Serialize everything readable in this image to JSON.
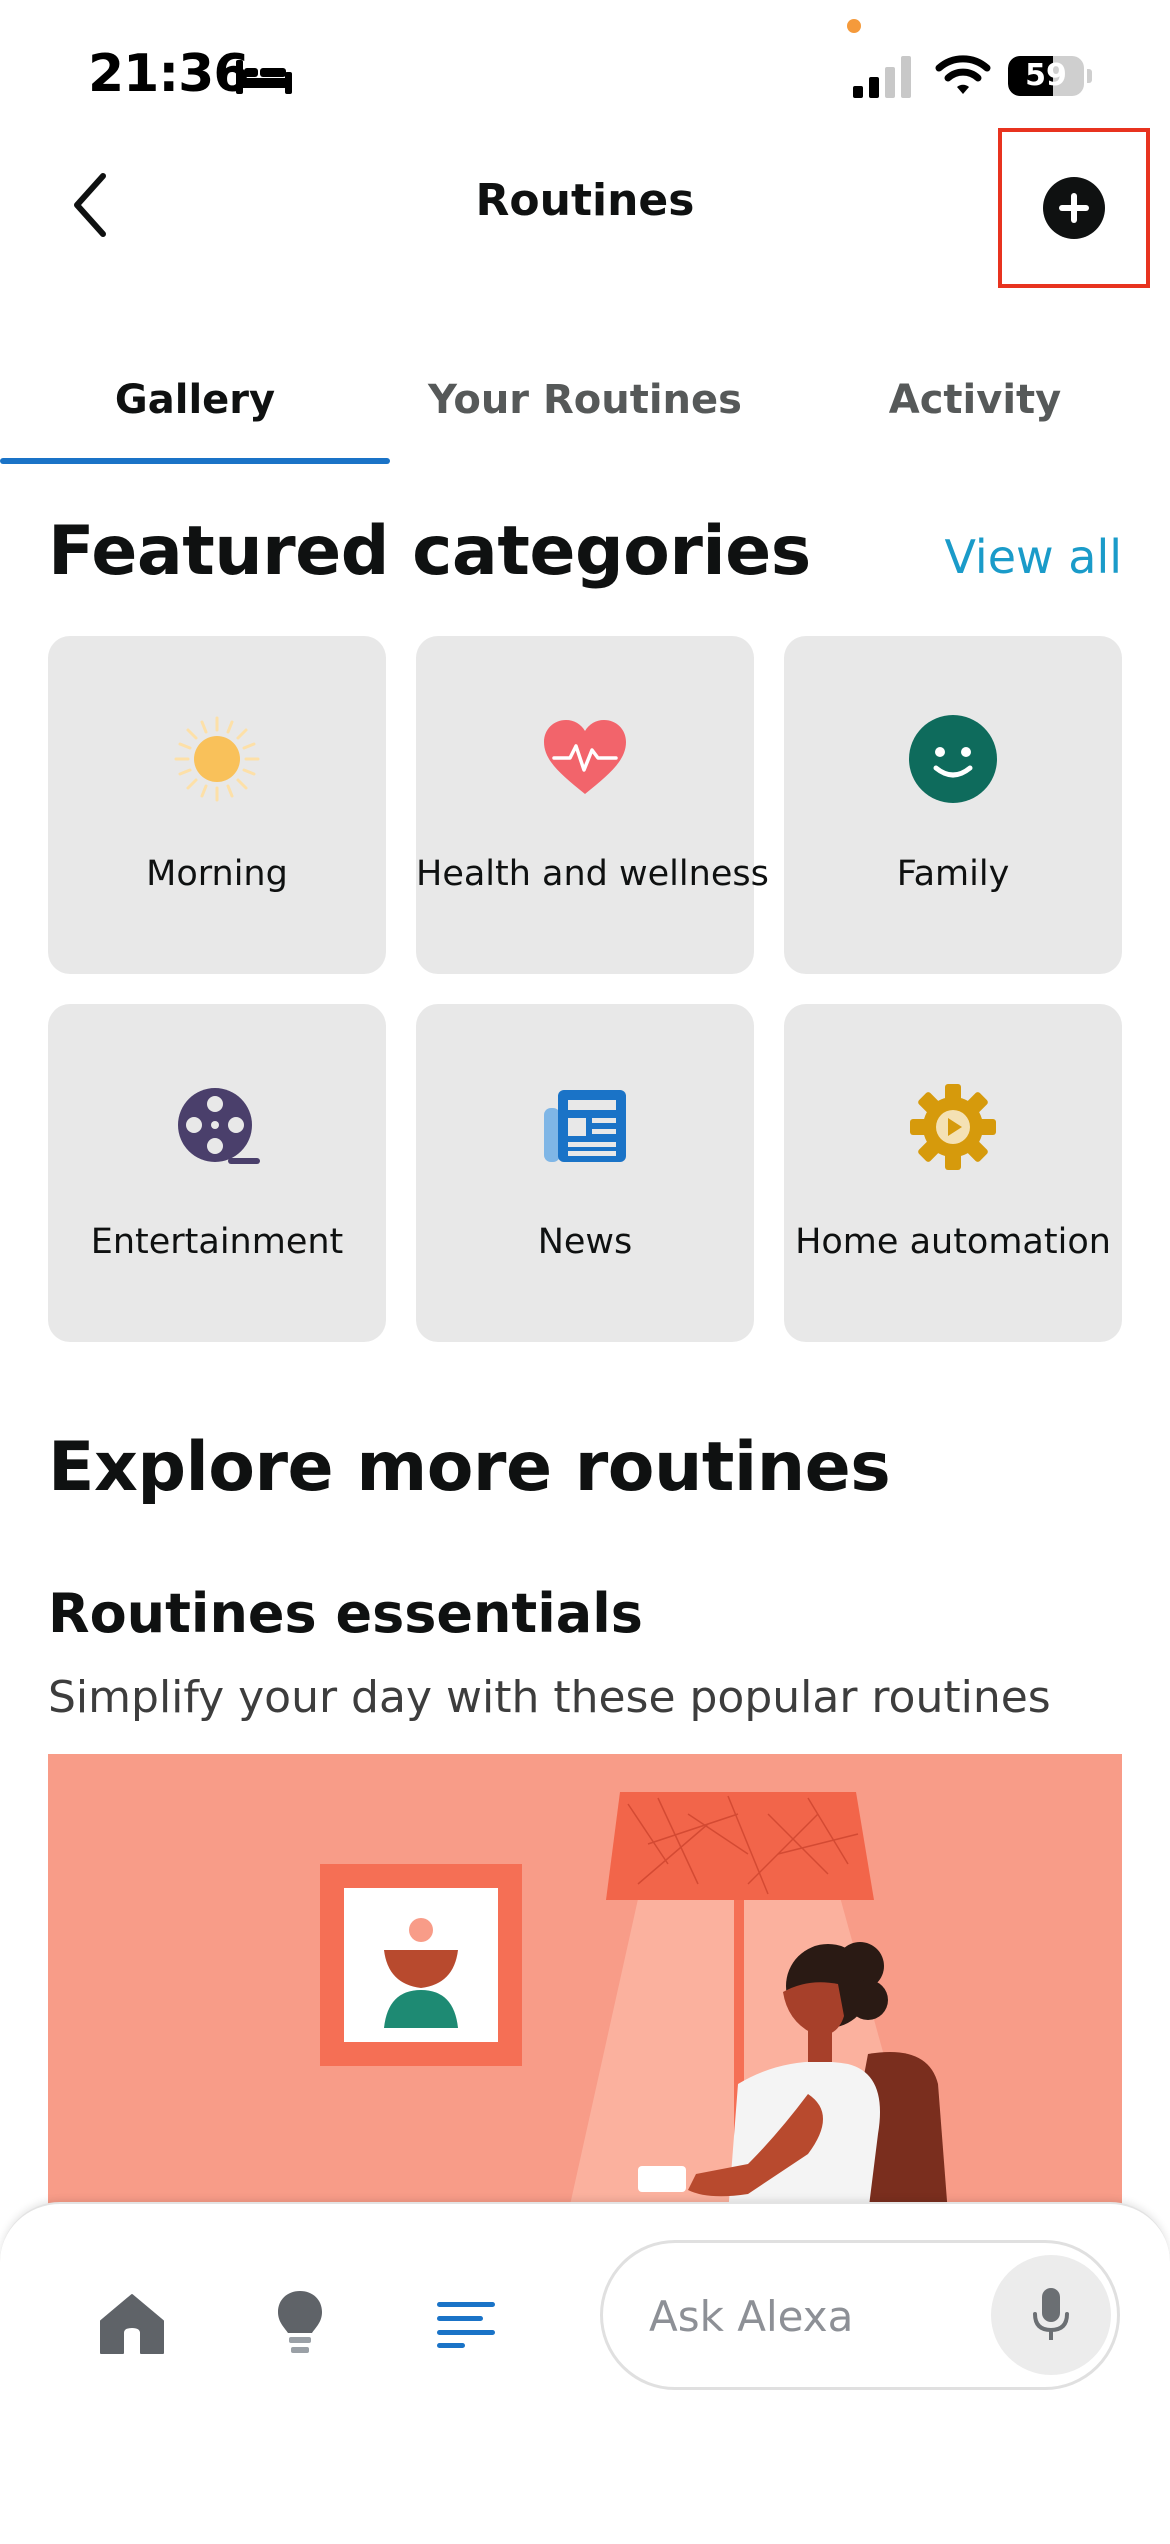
{
  "status_bar": {
    "time": "21:36",
    "battery_level": "59",
    "battery_fraction": 0.59,
    "icons": [
      "bed-icon",
      "signal-icon",
      "wifi-icon",
      "battery-icon"
    ]
  },
  "header": {
    "title": "Routines",
    "back_icon": "chevron-left-icon",
    "add_icon": "plus-circle-icon"
  },
  "tabs": [
    {
      "label": "Gallery",
      "active": true
    },
    {
      "label": "Your Routines",
      "active": false
    },
    {
      "label": "Activity",
      "active": false
    }
  ],
  "featured": {
    "title": "Featured categories",
    "view_all": "View all",
    "categories": [
      {
        "label": "Morning",
        "icon": "sun-icon",
        "color": "#f9c15a"
      },
      {
        "label": "Health and wellness",
        "icon": "heart-pulse-icon",
        "color": "#f2646b"
      },
      {
        "label": "Family",
        "icon": "smiley-face-icon",
        "color": "#0e6b5c"
      },
      {
        "label": "Entertainment",
        "icon": "film-reel-icon",
        "color": "#4a3f6b"
      },
      {
        "label": "News",
        "icon": "newspaper-icon",
        "color": "#1a73c7"
      },
      {
        "label": "Home automation",
        "icon": "gear-play-icon",
        "color": "#d69a0c"
      }
    ]
  },
  "explore": {
    "title": "Explore more routines",
    "essentials_title": "Routines essentials",
    "essentials_subtitle": "Simplify your day with these popular routines",
    "banner_color": "#f89c88"
  },
  "bottom_bar": {
    "nav_icons": [
      "home-icon",
      "lightbulb-icon",
      "routines-menu-icon"
    ],
    "ask_placeholder": "Ask Alexa",
    "mic_icon": "microphone-icon",
    "active_color": "#1a73c7"
  }
}
